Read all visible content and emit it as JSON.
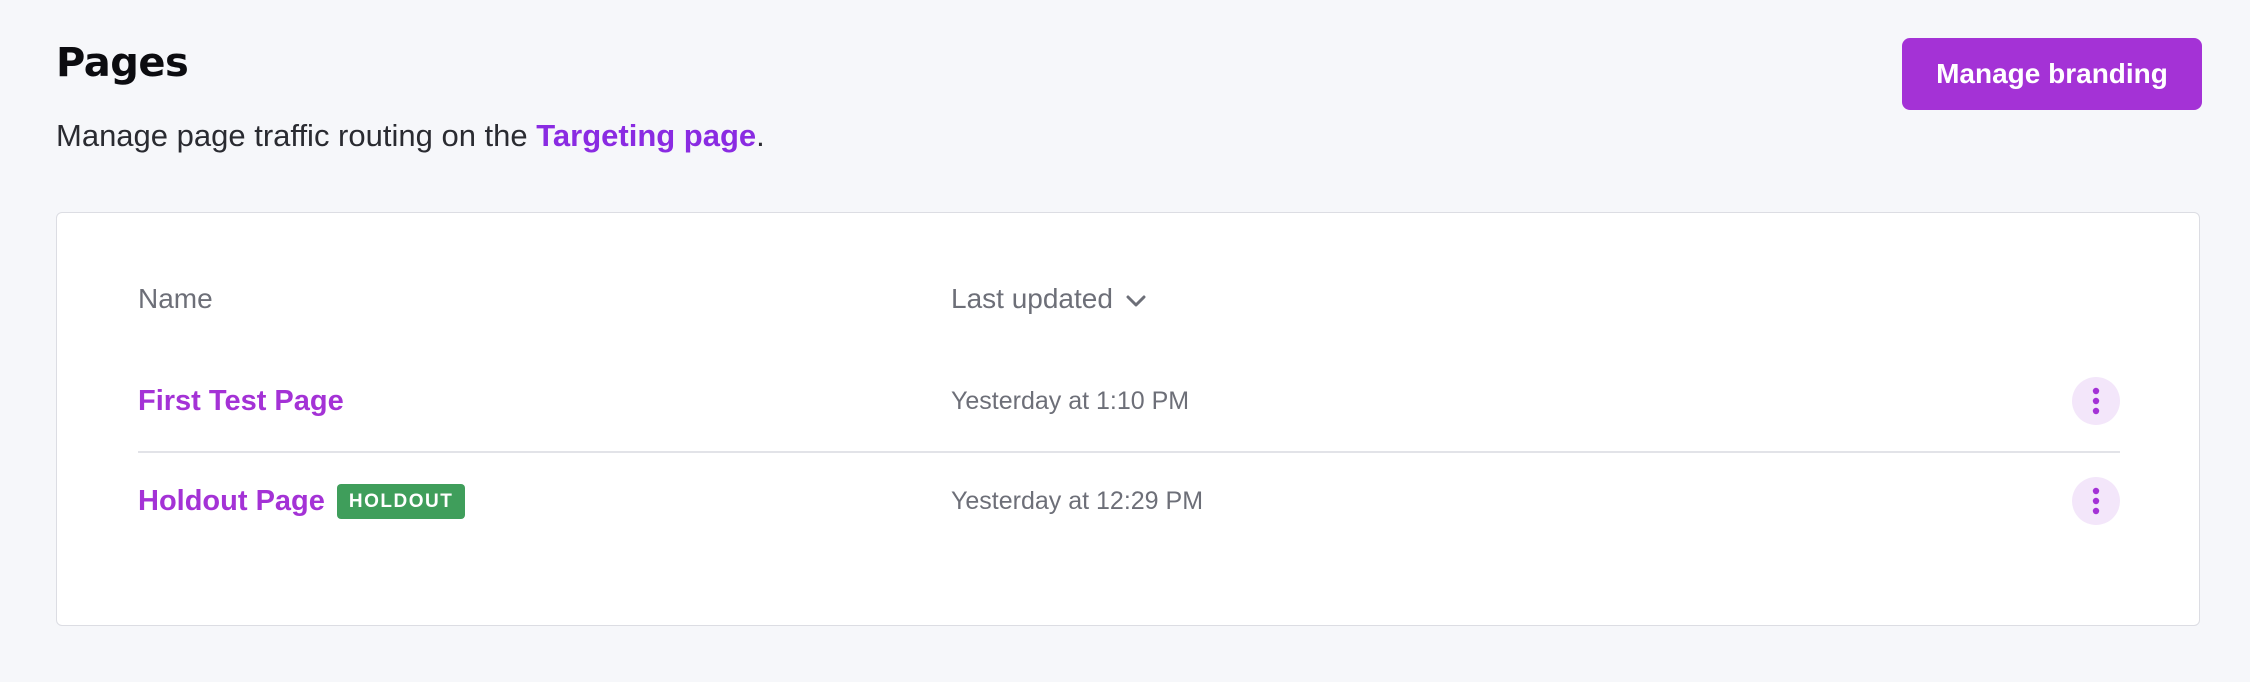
{
  "header": {
    "title": "Pages",
    "subtitle_prefix": "Manage page traffic routing on the ",
    "subtitle_link": "Targeting page",
    "subtitle_suffix": ".",
    "primary_button": "Manage branding"
  },
  "table": {
    "columns": {
      "name": "Name",
      "last_updated": "Last updated",
      "sort_icon": "chevron-down-icon"
    },
    "rows": [
      {
        "name": "First Test Page",
        "badge": "",
        "updated": "Yesterday at 1:10 PM",
        "actions_icon": "more-vertical-icon"
      },
      {
        "name": "Holdout Page",
        "badge": "HOLDOUT",
        "updated": "Yesterday at 12:29 PM",
        "actions_icon": "more-vertical-icon"
      }
    ]
  },
  "colors": {
    "accent": "#a432d6",
    "link": "#8a2be2",
    "badge_green": "#3f9e5b",
    "background": "#f6f7fa"
  }
}
